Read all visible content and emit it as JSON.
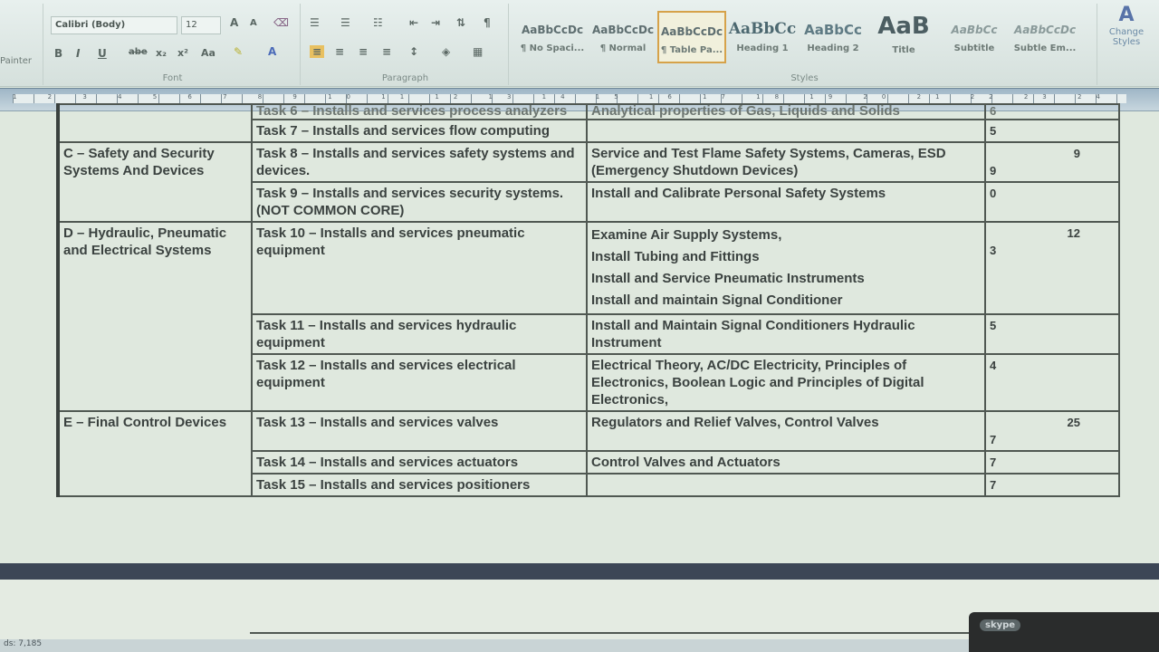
{
  "ribbon": {
    "clipboard": {
      "painter_label": "Painter"
    },
    "font": {
      "font_name": "Calibri (Body)",
      "font_size": "12",
      "group_label": "Font",
      "row1": [
        "A",
        "A",
        "Aa"
      ],
      "row2": [
        "B",
        "I",
        "U",
        "abe",
        "x₂",
        "x²",
        "Aa"
      ]
    },
    "paragraph": {
      "group_label": "Paragraph"
    },
    "styles": {
      "group_label": "Styles",
      "tiles": [
        {
          "preview": "AaBbCcDc",
          "name": "¶ No Spaci..."
        },
        {
          "preview": "AaBbCcDc",
          "name": "¶ Normal"
        },
        {
          "preview": "AaBbCcDc",
          "name": "¶ Table Pa..."
        },
        {
          "preview": "AaBbCc",
          "name": "Heading 1"
        },
        {
          "preview": "AaBbCc",
          "name": "Heading 2"
        },
        {
          "preview": "AaB",
          "name": "Title"
        },
        {
          "preview": "AaBbCc",
          "name": "Subtitle"
        },
        {
          "preview": "AaBbCcDc",
          "name": "Subtle Em..."
        }
      ]
    },
    "change_styles": {
      "line1": "Change",
      "line2": "Styles"
    }
  },
  "ruler": {
    "numbers": "1 2 3 4 5 6 7 8 9 10 11 12 13 14 15 16 17 18 19 20 21 22 23 24 25"
  },
  "table": {
    "rows": [
      {
        "section": "",
        "section_total": "",
        "tasks": [
          {
            "task": "Task 6 – Installs and services process analyzers",
            "content": "Analytical properties of Gas, Liquids and Solids",
            "hours": "6",
            "cut": true
          },
          {
            "task": "Task 7 – Installs and services flow computing",
            "content": "",
            "hours": "5"
          }
        ]
      },
      {
        "section": "C – Safety and Security Systems And Devices",
        "section_total": "9",
        "tasks": [
          {
            "task": "Task 8 – Installs and services safety systems and devices.",
            "content": "Service and Test Flame Safety Systems, Cameras, ESD (Emergency Shutdown Devices)",
            "hours": "9"
          },
          {
            "task": "Task 9 – Installs and services security systems. (NOT COMMON CORE)",
            "content": "Install and Calibrate Personal Safety Systems",
            "hours": "0"
          }
        ]
      },
      {
        "section": "D – Hydraulic, Pneumatic and Electrical Systems",
        "section_total": "12",
        "tasks": [
          {
            "task": "Task 10 – Installs and services pneumatic equipment",
            "content_lines": [
              "Examine Air Supply Systems,",
              "Install Tubing and Fittings",
              "Install and Service Pneumatic Instruments",
              "Install and maintain Signal Conditioner"
            ],
            "hours": "3"
          },
          {
            "task": "Task 11 – Installs and services hydraulic equipment",
            "content": "Install and Maintain Signal Conditioners Hydraulic Instrument",
            "hours": "5"
          },
          {
            "task": "Task 12 – Installs and services electrical equipment",
            "content": "Electrical Theory, AC/DC Electricity, Principles of Electronics, Boolean Logic and Principles of Digital Electronics,",
            "hours": "4"
          }
        ]
      },
      {
        "section": "E – Final Control Devices",
        "section_total": "25",
        "tasks": [
          {
            "task": "Task 13 – Installs and services valves",
            "content": "Regulators and Relief Valves, Control Valves",
            "hours": "7"
          },
          {
            "task": "Task 14 – Installs and services actuators",
            "content": "Control Valves and Actuators",
            "hours": "7"
          },
          {
            "task": "Task 15 – Installs and services positioners",
            "content": "",
            "hours": "7"
          }
        ]
      }
    ]
  },
  "status": {
    "text": "ds: 7,185"
  },
  "skype": {
    "label": "skype"
  }
}
